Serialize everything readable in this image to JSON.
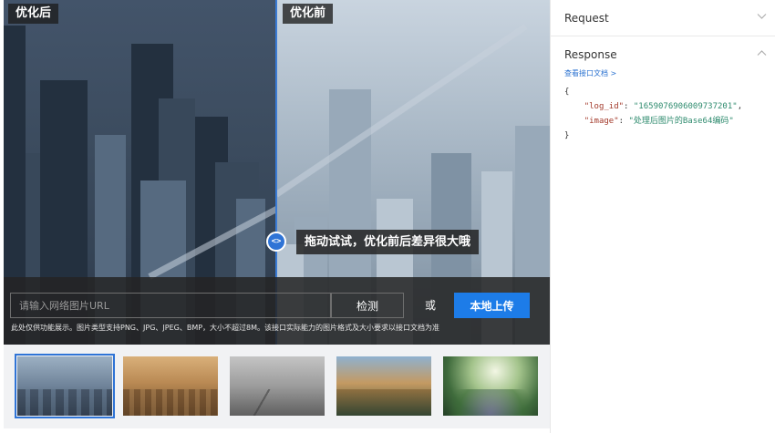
{
  "demo": {
    "label_after": "优化后",
    "label_before": "优化前",
    "drag_tip": "拖动试试，优化前后差异很大哦",
    "handle_icon": "drag-handle-icon",
    "handle_glyph": "<>"
  },
  "input": {
    "url_placeholder": "请输入网络图片URL",
    "detect_label": "检测",
    "or_label": "或",
    "upload_label": "本地上传",
    "disclaimer": "此处仅供功能展示。图片类型支持PNG、JPG、JPEG、BMP，大小不超过8M。该接口实际能力的图片格式及大小要求以接口文档为准"
  },
  "thumbnails": {
    "selected_index": 0,
    "count": 5
  },
  "api": {
    "request_title": "Request",
    "response_title": "Response",
    "doc_link": "查看接口文档 >",
    "brace_open": "{",
    "brace_close": "}",
    "log_id_key": "\"log_id\"",
    "log_id_value": "\"1659076906009737201\"",
    "image_key": "\"image\"",
    "image_value": "\"处理后图片的Base64编码\"",
    "request_icon": "chevron-down-icon",
    "response_icon": "chevron-up-icon"
  },
  "colors": {
    "accent": "#1d7ce8",
    "divider": "#2f74d6"
  }
}
